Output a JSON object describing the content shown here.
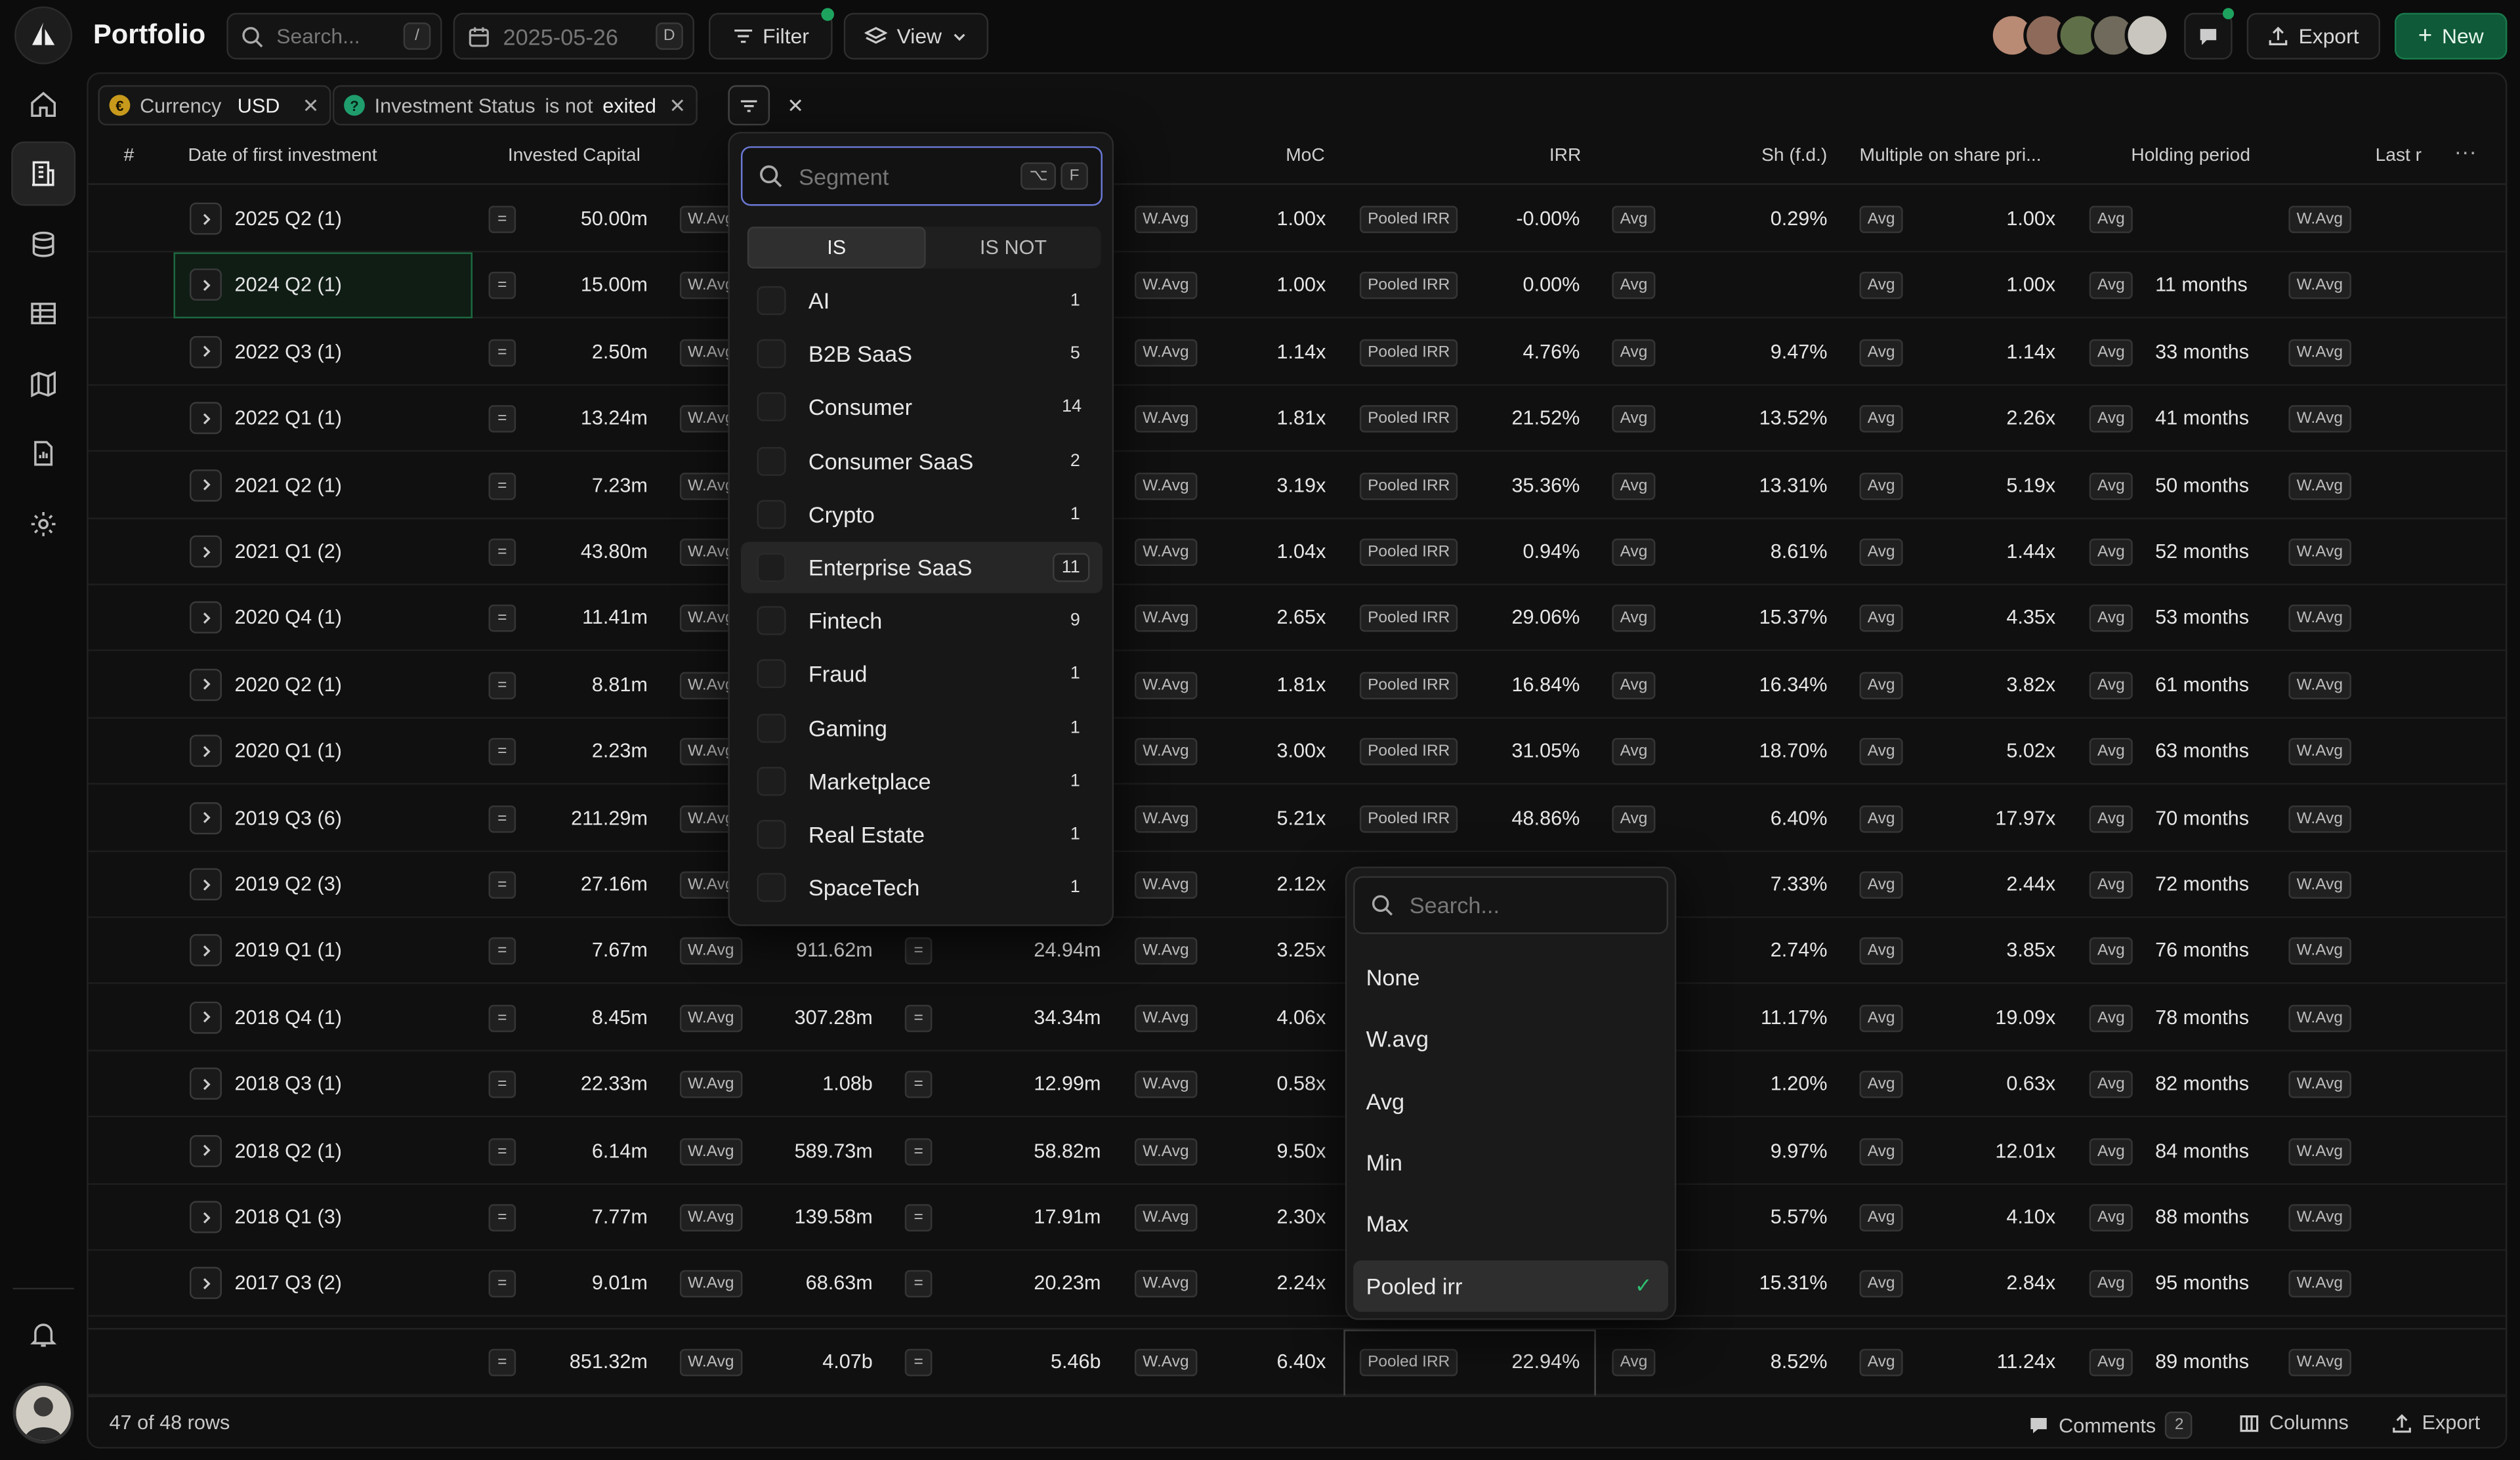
{
  "app": {
    "title": "Portfolio"
  },
  "toolbar": {
    "search_placeholder": "Search...",
    "search_kbd": "/",
    "date": "2025-05-26",
    "date_kbd": "D",
    "filter_label": "Filter",
    "view_label": "View",
    "export_label": "Export",
    "new_label": "New"
  },
  "filters": [
    {
      "field": "Currency",
      "operator": "",
      "value": "USD"
    },
    {
      "field": "Investment Status",
      "operator": "is not",
      "value": "exited"
    }
  ],
  "columns": [
    "#",
    "Date of first investment",
    "Invested Capital",
    "MoC",
    "IRR",
    "Sh (f.d.)",
    "Multiple on share pri...",
    "Holding period",
    "Last r"
  ],
  "rows": [
    {
      "label": "2025 Q2 (1)",
      "invested": "50.00m",
      "c3": "",
      "c4": "",
      "moc": "1.00x",
      "irr": "-0.00%",
      "sh": "0.29%",
      "mult": "1.00x",
      "hold": ""
    },
    {
      "label": "2024 Q2 (1)",
      "invested": "15.00m",
      "c3": "",
      "c4": "",
      "moc": "1.00x",
      "irr": "0.00%",
      "sh": "",
      "mult": "1.00x",
      "hold": "11 months"
    },
    {
      "label": "2022 Q3 (1)",
      "invested": "2.50m",
      "c3": "",
      "c4": "",
      "moc": "1.14x",
      "irr": "4.76%",
      "sh": "9.47%",
      "mult": "1.14x",
      "hold": "33 months"
    },
    {
      "label": "2022 Q1 (1)",
      "invested": "13.24m",
      "c3": "",
      "c4": "",
      "moc": "1.81x",
      "irr": "21.52%",
      "sh": "13.52%",
      "mult": "2.26x",
      "hold": "41 months"
    },
    {
      "label": "2021 Q2 (1)",
      "invested": "7.23m",
      "c3": "",
      "c4": "",
      "moc": "3.19x",
      "irr": "35.36%",
      "sh": "13.31%",
      "mult": "5.19x",
      "hold": "50 months"
    },
    {
      "label": "2021 Q1 (2)",
      "invested": "43.80m",
      "c3": "",
      "c4": "",
      "moc": "1.04x",
      "irr": "0.94%",
      "sh": "8.61%",
      "mult": "1.44x",
      "hold": "52 months"
    },
    {
      "label": "2020 Q4 (1)",
      "invested": "11.41m",
      "c3": "",
      "c4": "",
      "moc": "2.65x",
      "irr": "29.06%",
      "sh": "15.37%",
      "mult": "4.35x",
      "hold": "53 months"
    },
    {
      "label": "2020 Q2 (1)",
      "invested": "8.81m",
      "c3": "",
      "c4": "",
      "moc": "1.81x",
      "irr": "16.84%",
      "sh": "16.34%",
      "mult": "3.82x",
      "hold": "61 months"
    },
    {
      "label": "2020 Q1 (1)",
      "invested": "2.23m",
      "c3": "",
      "c4": "",
      "moc": "3.00x",
      "irr": "31.05%",
      "sh": "18.70%",
      "mult": "5.02x",
      "hold": "63 months"
    },
    {
      "label": "2019 Q3 (6)",
      "invested": "211.29m",
      "c3": "",
      "c4": "",
      "moc": "5.21x",
      "irr": "48.86%",
      "sh": "6.40%",
      "mult": "17.97x",
      "hold": "70 months"
    },
    {
      "label": "2019 Q2 (3)",
      "invested": "27.16m",
      "c3": "",
      "c4": "",
      "moc": "2.12x",
      "irr": "",
      "sh": "7.33%",
      "mult": "2.44x",
      "hold": "72 months"
    },
    {
      "label": "2019 Q1 (1)",
      "invested": "7.67m",
      "c3": "911.62m",
      "c4": "24.94m",
      "moc": "3.25x",
      "irr": "",
      "sh": "2.74%",
      "mult": "3.85x",
      "hold": "76 months"
    },
    {
      "label": "2018 Q4 (1)",
      "invested": "8.45m",
      "c3": "307.28m",
      "c4": "34.34m",
      "moc": "4.06x",
      "irr": "",
      "sh": "11.17%",
      "mult": "19.09x",
      "hold": "78 months"
    },
    {
      "label": "2018 Q3 (1)",
      "invested": "22.33m",
      "c3": "1.08b",
      "c4": "12.99m",
      "moc": "0.58x",
      "irr": "",
      "sh": "1.20%",
      "mult": "0.63x",
      "hold": "82 months"
    },
    {
      "label": "2018 Q2 (1)",
      "invested": "6.14m",
      "c3": "589.73m",
      "c4": "58.82m",
      "moc": "9.50x",
      "irr": "",
      "sh": "9.97%",
      "mult": "12.01x",
      "hold": "84 months"
    },
    {
      "label": "2018 Q1 (3)",
      "invested": "7.77m",
      "c3": "139.58m",
      "c4": "17.91m",
      "moc": "2.30x",
      "irr": "",
      "sh": "5.57%",
      "mult": "4.10x",
      "hold": "88 months"
    },
    {
      "label": "2017 Q3 (2)",
      "invested": "9.01m",
      "c3": "68.63m",
      "c4": "20.23m",
      "moc": "2.24x",
      "irr": "",
      "sh": "15.31%",
      "mult": "2.84x",
      "hold": "95 months"
    }
  ],
  "totals": {
    "invested": "851.32m",
    "c3": "4.07b",
    "c4": "5.46b",
    "moc": "6.40x",
    "irr": "22.94%",
    "sh": "8.52%",
    "mult": "11.24x",
    "hold": "89 months"
  },
  "tags": {
    "eq": "=",
    "wavg": "W.Avg",
    "avg": "Avg",
    "pooled": "Pooled IRR"
  },
  "segment_dropdown": {
    "placeholder": "Segment",
    "kbd1": "⌥",
    "kbd2": "F",
    "toggle": [
      "IS",
      "IS NOT"
    ],
    "options": [
      {
        "label": "AI",
        "count": "1"
      },
      {
        "label": "B2B SaaS",
        "count": "5"
      },
      {
        "label": "Consumer",
        "count": "14"
      },
      {
        "label": "Consumer SaaS",
        "count": "2"
      },
      {
        "label": "Crypto",
        "count": "1"
      },
      {
        "label": "Enterprise SaaS",
        "count": "11"
      },
      {
        "label": "Fintech",
        "count": "9"
      },
      {
        "label": "Fraud",
        "count": "1"
      },
      {
        "label": "Gaming",
        "count": "1"
      },
      {
        "label": "Marketplace",
        "count": "1"
      },
      {
        "label": "Real Estate",
        "count": "1"
      },
      {
        "label": "SpaceTech",
        "count": "1"
      }
    ],
    "highlighted": "Enterprise SaaS"
  },
  "agg_dropdown": {
    "placeholder": "Search...",
    "options": [
      "None",
      "W.avg",
      "Avg",
      "Min",
      "Max",
      "Pooled irr"
    ],
    "selected": "Pooled irr"
  },
  "footer": {
    "rows_label": "47 of 48 rows",
    "comments_label": "Comments",
    "comments_count": "2",
    "columns_label": "Columns",
    "export_label": "Export"
  },
  "colors": {
    "accent_green": "#0f5a38",
    "focus_blue": "#6b79d6",
    "selected_cell": "#1d6a40"
  }
}
